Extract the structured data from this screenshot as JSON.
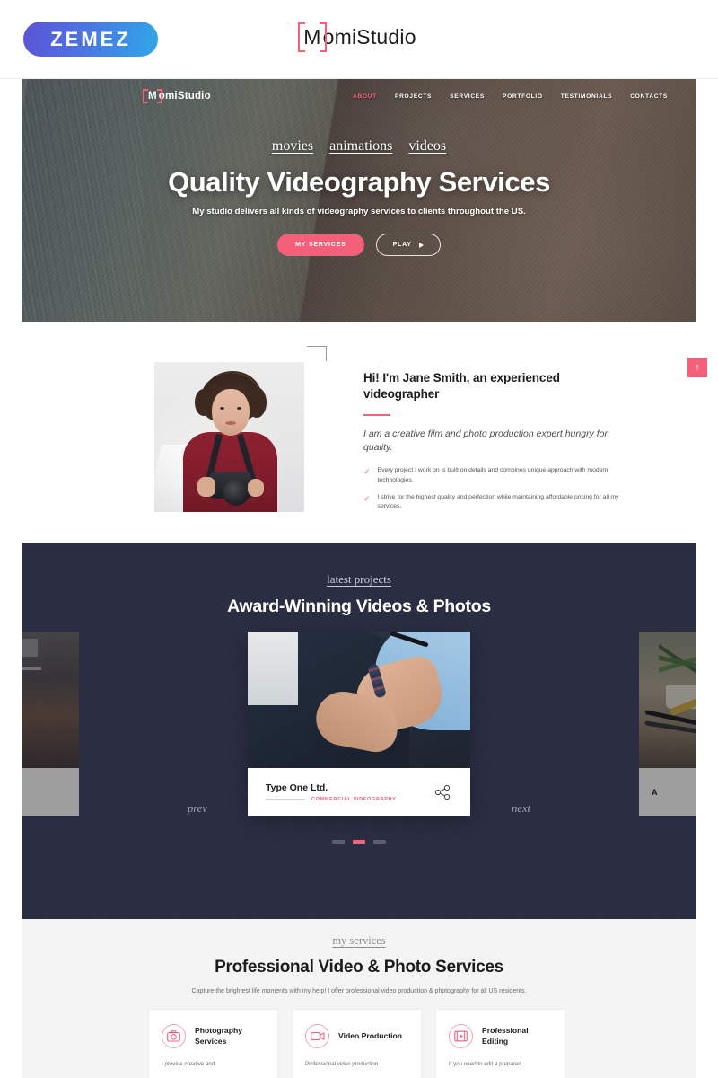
{
  "topbar": {
    "logo_text": "ZEMEZ",
    "title_bracket": "M",
    "title_rest": "omiStudio"
  },
  "hero": {
    "logo_bracket": "M",
    "logo_rest": "omiStudio",
    "menu": [
      {
        "label": "ABOUT",
        "active": true
      },
      {
        "label": "PROJECTS",
        "active": false
      },
      {
        "label": "SERVICES",
        "active": false
      },
      {
        "label": "PORTFOLIO",
        "active": false
      },
      {
        "label": "TESTIMONIALS",
        "active": false
      },
      {
        "label": "CONTACTS",
        "active": false
      }
    ],
    "tags": [
      "movies",
      "animations",
      "videos"
    ],
    "heading": "Quality Videography Services",
    "subheading": "My studio delivers all kinds of videography services to clients throughout the US.",
    "primary_button": "MY SERVICES",
    "secondary_button": "PLAY"
  },
  "about": {
    "heading": "Hi! I'm Jane Smith, an experienced videographer",
    "lead": "I am a creative film and photo production expert hungry for quality.",
    "bullets": [
      "Every project I work on is built on details and combines unique approach with modern technologies.",
      "I strive for the highest quality and perfection while maintaining affordable pricing for all my services."
    ]
  },
  "back_to_top": {
    "label": "↑"
  },
  "projects": {
    "eyebrow": "latest projects",
    "heading": "Award-Winning Videos & Photos",
    "prev_label": "prev",
    "next_label": "next",
    "slide": {
      "title": "Type One Ltd.",
      "category": "COMMERCIAL VIDEOGRAPHY"
    },
    "side_right_title": "A",
    "dots": [
      {
        "active": false
      },
      {
        "active": true
      },
      {
        "active": false
      }
    ]
  },
  "services": {
    "eyebrow": "my services",
    "heading": "Professional Video & Photo Services",
    "subheading": "Capture the brightest life moments with my help! I offer professional video production & photography for all US residents.",
    "cards": [
      {
        "icon": "camera-icon",
        "title": "Photography Services",
        "body": "I provide creative and"
      },
      {
        "icon": "video-camera-icon",
        "title": "Video Production",
        "body": "Professional video production"
      },
      {
        "icon": "film-play-icon",
        "title": "Professional Editing",
        "body": "If you need to edit a prepared"
      }
    ]
  },
  "colors": {
    "accent": "#f4607a",
    "dark": "#2b2e42",
    "light_section": "#f4f4f4"
  }
}
